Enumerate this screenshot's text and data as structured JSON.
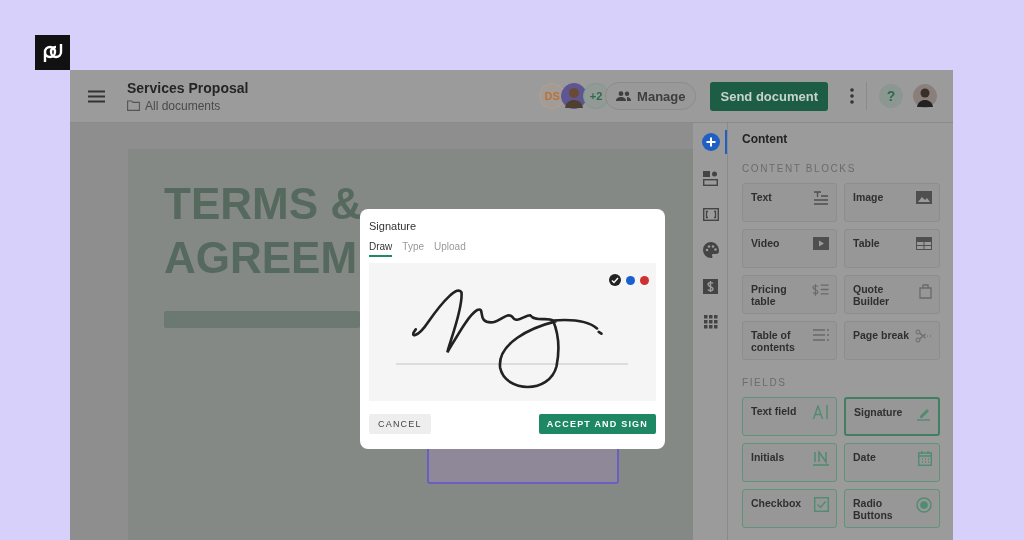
{
  "document": {
    "title": "Services Proposal",
    "folder": "All documents"
  },
  "collaborators": {
    "initials": "DS",
    "extra": "+2",
    "manage": "Manage"
  },
  "send_button": "Send document",
  "help": "?",
  "page": {
    "heading_lines": [
      "TERMS &",
      "AGREEM"
    ]
  },
  "rail": [
    {
      "selected": true
    },
    {
      "selected": false
    },
    {
      "selected": false
    },
    {
      "selected": false
    },
    {
      "selected": false
    },
    {
      "selected": false
    }
  ],
  "panel": {
    "title": "Content",
    "blocks_heading": "CONTENT BLOCKS",
    "blocks": [
      {
        "label": "Text"
      },
      {
        "label": "Image"
      },
      {
        "label": "Video"
      },
      {
        "label": "Table"
      },
      {
        "label": "Pricing table"
      },
      {
        "label": "Quote Builder"
      },
      {
        "label": "Table of contents"
      },
      {
        "label": "Page break"
      }
    ],
    "fields_heading": "FIELDS",
    "fields": [
      {
        "label": "Text field",
        "selected": false
      },
      {
        "label": "Signature",
        "selected": true
      },
      {
        "label": "Initials",
        "selected": false
      },
      {
        "label": "Date",
        "selected": false
      },
      {
        "label": "Checkbox",
        "selected": false
      },
      {
        "label": "Radio Buttons",
        "selected": false
      }
    ]
  },
  "dialog": {
    "title": "Signature",
    "tabs": [
      {
        "label": "Draw",
        "selected": true
      },
      {
        "label": "Type",
        "selected": false
      },
      {
        "label": "Upload",
        "selected": false
      }
    ],
    "ink_colors": [
      {
        "color": "#222222",
        "selected": true
      },
      {
        "color": "#1a5fd0",
        "selected": false
      },
      {
        "color": "#d03030",
        "selected": false
      }
    ],
    "cancel": "CANCEL",
    "accept": "ACCEPT AND SIGN"
  }
}
